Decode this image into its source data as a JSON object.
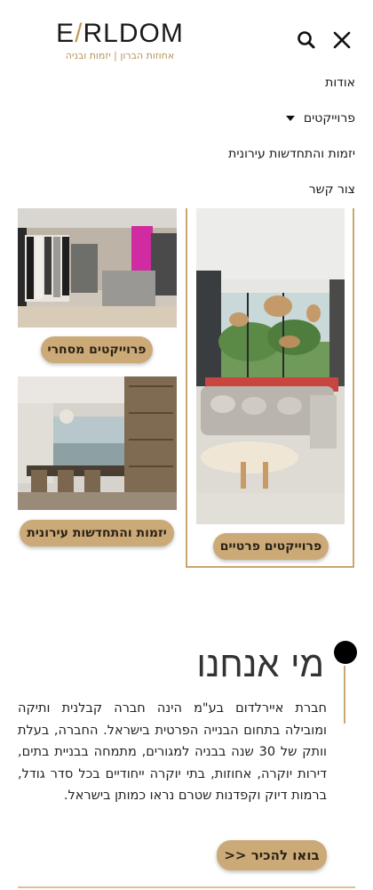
{
  "header": {
    "logo_text": "EARLDOM",
    "logo_subtitle": "אחוזות הברון | יזמות ובניה",
    "search_icon": "search-icon",
    "close_icon": "close-icon"
  },
  "menu": {
    "items": [
      {
        "label": "אודות"
      },
      {
        "label": "פרוייקטים",
        "has_dropdown": true
      },
      {
        "label": "יזמות והתחדשות עירונית"
      },
      {
        "label": "צור קשר"
      }
    ]
  },
  "gallery": {
    "private_label": "פרוייקטים פרטיים",
    "commercial_label": "פרוייקטים מסחרי",
    "urban_label": "יזמות והתחדשות עירונית"
  },
  "about": {
    "title": "מי אנחנו",
    "text": "חברת איירלדום בע\"מ הינה חברה קבלנית ותיקה ומובילה בתחום הבנייה הפרטית בישראל. החברה, בעלת וותק של 30 שנה בבניה למגורים, מתמחה בבניית בתים, דירות יוקרה, אחוזות, בתי יוקרה ייחודיים בכל סדר גודל, ברמות דיוק וקפדנות שטרם נראו כמותן בישראל.",
    "cta_label": "בואו להכיר <<"
  },
  "colors": {
    "accent": "#c9a76e",
    "button": "#cbaa78"
  }
}
